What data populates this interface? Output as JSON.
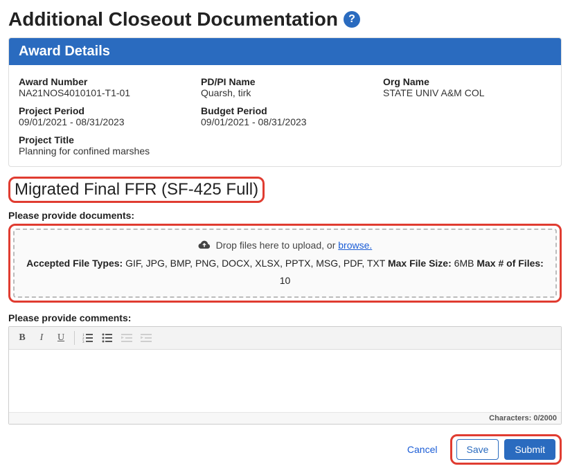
{
  "page": {
    "title": "Additional Closeout Documentation"
  },
  "award": {
    "header": "Award Details",
    "fields": {
      "award_number_label": "Award Number",
      "award_number": "NA21NOS4010101-T1-01",
      "pdpi_label": "PD/PI Name",
      "pdpi": "Quarsh, tirk",
      "org_label": "Org Name",
      "org": "STATE UNIV A&M COL",
      "project_period_label": "Project Period",
      "project_period": "09/01/2021 - 08/31/2023",
      "budget_period_label": "Budget Period",
      "budget_period": "09/01/2021 - 08/31/2023",
      "project_title_label": "Project Title",
      "project_title": "Planning for  confined marshes"
    }
  },
  "section": {
    "title": "Migrated Final FFR (SF-425 Full)"
  },
  "documents": {
    "label": "Please provide documents:",
    "drop_text": "Drop files here to upload, or ",
    "browse": "browse.",
    "accepted_label": "Accepted File Types:",
    "accepted": " GIF, JPG, BMP, PNG, DOCX, XLSX, PPTX, MSG, PDF, TXT ",
    "max_size_label": "Max File Size:",
    "max_size": " 6MB ",
    "max_files_label": "Max # of Files:",
    "max_files": " 10"
  },
  "comments": {
    "label": "Please provide comments:",
    "char_label": "Characters: ",
    "char_count": "0/2000"
  },
  "toolbar": {
    "bold": "B",
    "italic": "I",
    "underline": "U"
  },
  "actions": {
    "cancel": "Cancel",
    "save": "Save",
    "submit": "Submit"
  }
}
